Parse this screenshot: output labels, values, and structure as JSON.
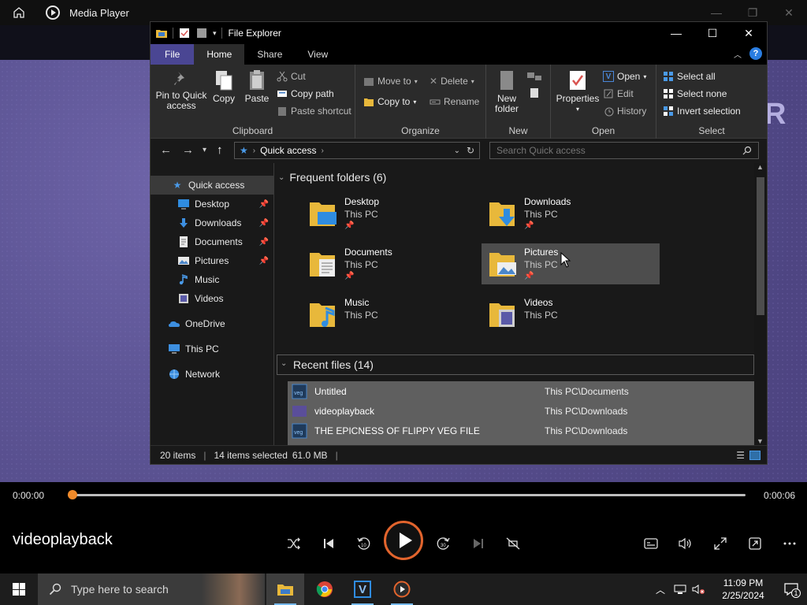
{
  "media_player": {
    "title": "Media Player",
    "now_playing": "videoplayback",
    "time_current": "0:00:00",
    "time_total": "0:00:06",
    "progress": 0.0,
    "accent": "#e2642d",
    "overlay_text": "R"
  },
  "explorer": {
    "title": "File Explorer",
    "tabs": [
      "File",
      "Home",
      "Share",
      "View"
    ],
    "ribbon": {
      "clipboard": {
        "label": "Clipboard",
        "pin_to_quick_access": "Pin to Quick access",
        "copy": "Copy",
        "paste": "Paste",
        "cut": "Cut",
        "copy_path": "Copy path",
        "paste_shortcut": "Paste shortcut"
      },
      "organize": {
        "label": "Organize",
        "move_to": "Move to",
        "copy_to": "Copy to",
        "delete": "Delete",
        "rename": "Rename"
      },
      "new": {
        "label": "New",
        "new_folder": "New folder"
      },
      "open": {
        "label": "Open",
        "properties": "Properties",
        "open": "Open",
        "edit": "Edit",
        "history": "History"
      },
      "select": {
        "label": "Select",
        "select_all": "Select all",
        "select_none": "Select none",
        "invert_selection": "Invert selection"
      }
    },
    "address": {
      "crumb": "Quick access",
      "search_placeholder": "Search Quick access"
    },
    "nav_pane": [
      {
        "label": "Quick access",
        "icon": "star-icon",
        "selected": true
      },
      {
        "label": "Desktop",
        "icon": "desktop-icon",
        "pinned": true
      },
      {
        "label": "Downloads",
        "icon": "download-icon",
        "pinned": true
      },
      {
        "label": "Documents",
        "icon": "documents-icon",
        "pinned": true
      },
      {
        "label": "Pictures",
        "icon": "pictures-icon",
        "pinned": true
      },
      {
        "label": "Music",
        "icon": "music-icon"
      },
      {
        "label": "Videos",
        "icon": "videos-icon"
      },
      {
        "label": "OneDrive",
        "icon": "cloud-icon"
      },
      {
        "label": "This PC",
        "icon": "computer-icon"
      },
      {
        "label": "Network",
        "icon": "network-icon"
      }
    ],
    "frequent": {
      "heading": "Frequent folders (6)",
      "folders": [
        {
          "name": "Desktop",
          "location": "This PC",
          "pinned": true
        },
        {
          "name": "Downloads",
          "location": "This PC",
          "pinned": true
        },
        {
          "name": "Documents",
          "location": "This PC",
          "pinned": true
        },
        {
          "name": "Pictures",
          "location": "This PC",
          "pinned": true
        },
        {
          "name": "Music",
          "location": "This PC",
          "pinned": false
        },
        {
          "name": "Videos",
          "location": "This PC",
          "pinned": false
        }
      ]
    },
    "recent": {
      "heading": "Recent files (14)",
      "files": [
        {
          "name": "Untitled",
          "location": "This PC\\Documents"
        },
        {
          "name": "videoplayback",
          "location": "This PC\\Downloads"
        },
        {
          "name": "THE EPICNESS OF FLIPPY VEG FILE",
          "location": "This PC\\Downloads"
        }
      ]
    },
    "status": {
      "items": "20 items",
      "selected": "14 items selected",
      "size": "61.0 MB"
    }
  },
  "taskbar": {
    "search_placeholder": "Type here to search",
    "time": "11:09 PM",
    "date": "2/25/2024",
    "notification_count": "1"
  }
}
